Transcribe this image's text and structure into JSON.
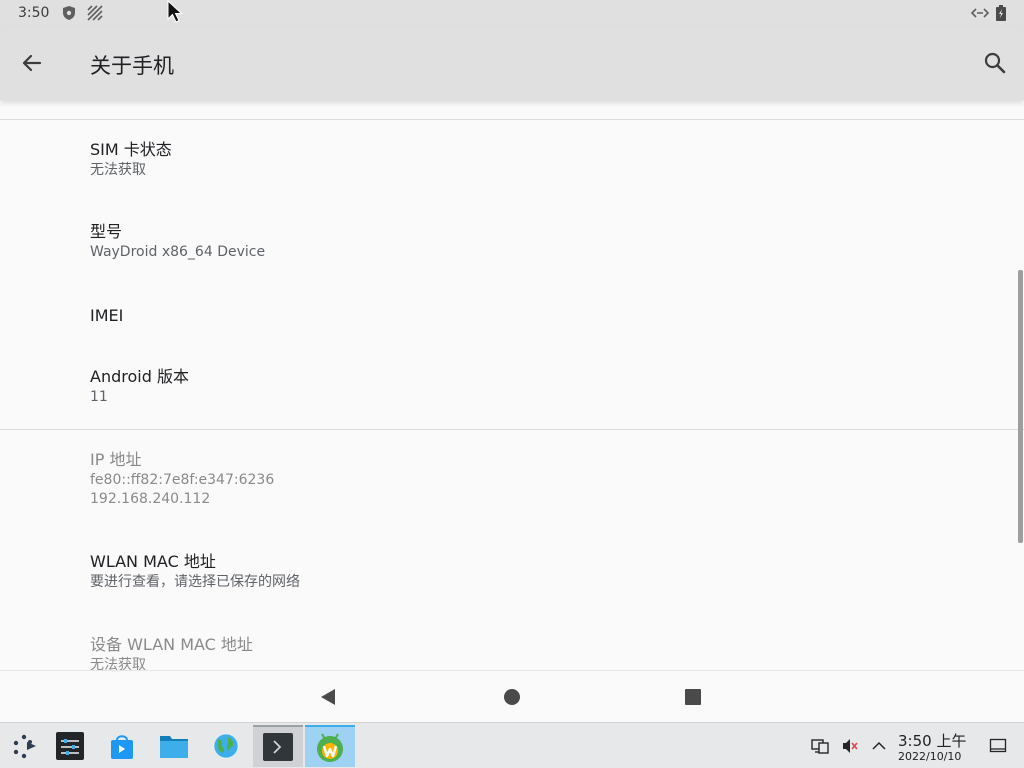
{
  "status_bar": {
    "time": "3:50",
    "icons": [
      "shield-icon",
      "no-data-stripes-icon",
      "ethernet-icon",
      "battery-icon"
    ]
  },
  "app_bar": {
    "title": "关于手机",
    "back_icon": "arrow-left-icon",
    "search_icon": "search-icon"
  },
  "settings": {
    "items": [
      {
        "title": "SIM 卡状态",
        "summary": "无法获取"
      },
      {
        "title": "型号",
        "summary": "WayDroid x86_64 Device"
      },
      {
        "title": "IMEI",
        "summary": ""
      },
      {
        "title": "Android 版本",
        "summary": "11"
      },
      {
        "title": "IP 地址",
        "summary": "fe80::ff82:7e8f:e347:6236",
        "summary2": "192.168.240.112"
      },
      {
        "title": "WLAN MAC 地址",
        "summary": "要进行查看，请选择已保存的网络"
      },
      {
        "title": "设备 WLAN MAC 地址",
        "summary": "无法获取"
      }
    ]
  },
  "nav_bar": {
    "buttons": [
      "back-triangle-icon",
      "home-circle-icon",
      "recents-square-icon"
    ]
  },
  "taskbar": {
    "apps": [
      "launcher-icon",
      "settings-sliders-icon",
      "store-bag-icon",
      "folder-icon",
      "globe-icon",
      "terminal-icon",
      "waydroid-icon"
    ],
    "tray": [
      "network-icon",
      "volume-muted-icon",
      "chevron-up-icon",
      "show-desktop-icon"
    ],
    "clock_time": "3:50 上午",
    "clock_date": "2022/10/10"
  },
  "colors": {
    "bar_bg": "#e0e0e0",
    "page_bg": "#fafafa",
    "accent": "#3daee9"
  }
}
